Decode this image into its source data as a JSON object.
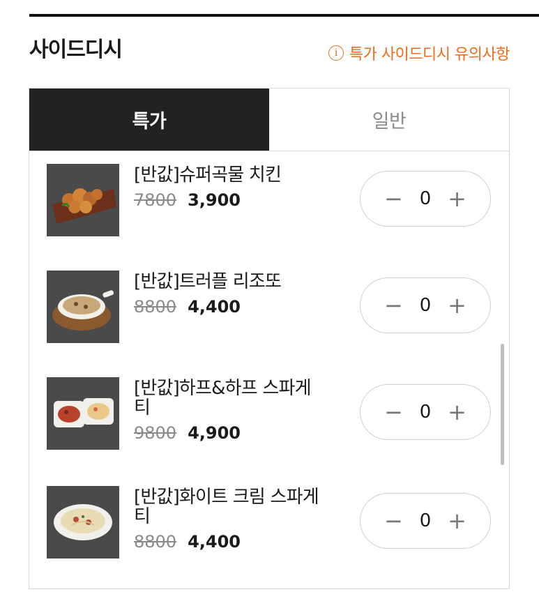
{
  "header": {
    "title": "사이드디시",
    "notice_label": "특가 사이드디시 유의사항",
    "info_icon": "i"
  },
  "tabs": [
    {
      "label": "특가",
      "active": true
    },
    {
      "label": "일반",
      "active": false
    }
  ],
  "items": [
    {
      "name": "[반값]슈퍼곡물 치킨",
      "original_price": "7800",
      "sale_price": "3,900",
      "quantity": "0",
      "image": "fried-chicken-on-board"
    },
    {
      "name": "[반값]트러플 리조또",
      "original_price": "8800",
      "sale_price": "4,400",
      "quantity": "0",
      "image": "risotto-bowl"
    },
    {
      "name": "[반값]하프&하프 스파게티",
      "original_price": "9800",
      "sale_price": "4,900",
      "quantity": "0",
      "image": "half-half-spaghetti"
    },
    {
      "name": "[반값]화이트 크림 스파게티",
      "original_price": "8800",
      "sale_price": "4,400",
      "quantity": "0",
      "image": "cream-spaghetti"
    }
  ],
  "stepper": {
    "minus": "−",
    "plus": "+"
  },
  "colors": {
    "accent": "#ee6a1b",
    "tab_active_bg": "#222222",
    "thumb_bg": "#4a4a4a"
  }
}
